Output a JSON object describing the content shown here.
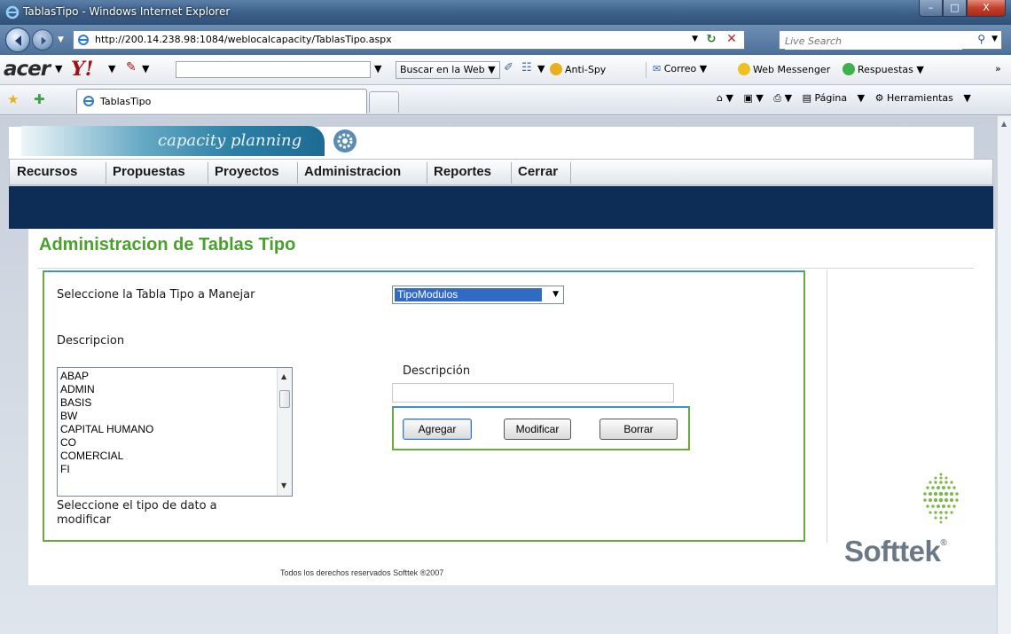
{
  "window": {
    "title": "TablasTipo - Windows Internet Explorer",
    "min": "–",
    "max": "□",
    "close": "X"
  },
  "address_bar": {
    "url": "http://200.14.238.98:1084/weblocalcapacity/TablasTipo.aspx",
    "search_placeholder": "Live Search"
  },
  "toolbar2": {
    "acer": "acer",
    "yahoo": "Y!",
    "buscar": "Buscar en la Web",
    "antispy": "Anti-Spy",
    "correo": "Correo",
    "messenger": "Web Messenger",
    "respuestas": "Respuestas"
  },
  "tab": {
    "label": "TablasTipo"
  },
  "tab_tools": {
    "pagina": "Página",
    "herramientas": "Herramientas"
  },
  "app": {
    "logo_text": "capacity planning",
    "menu": [
      "Recursos",
      "Propuestas",
      "Proyectos",
      "Administracion",
      "Reportes",
      "Cerrar"
    ],
    "page_title": "Administracion de Tablas Tipo",
    "select_label": "Seleccione la Tabla Tipo a Manejar",
    "select_value": "TipoModulos",
    "desc_label": "Descripcion",
    "list_items": [
      "ABAP",
      "ADMIN",
      "BASIS",
      "BW",
      "CAPITAL HUMANO",
      "CO",
      "COMERCIAL",
      "FI"
    ],
    "list_hint_1": "Seleccione el tipo de dato a",
    "list_hint_2": "modificar",
    "desc_field_label": "Descripción",
    "desc_field_value": "",
    "btn_add": "Agregar",
    "btn_edit": "Modificar",
    "btn_delete": "Borrar",
    "footer": "Todos los derechos reservados Softtek ®2007",
    "brand": "Softtek",
    "brand_reg": "®"
  },
  "colors": {
    "accent_green": "#4aa02c",
    "nav_dark": "#0e2d56",
    "selection_blue": "#316ac5"
  }
}
